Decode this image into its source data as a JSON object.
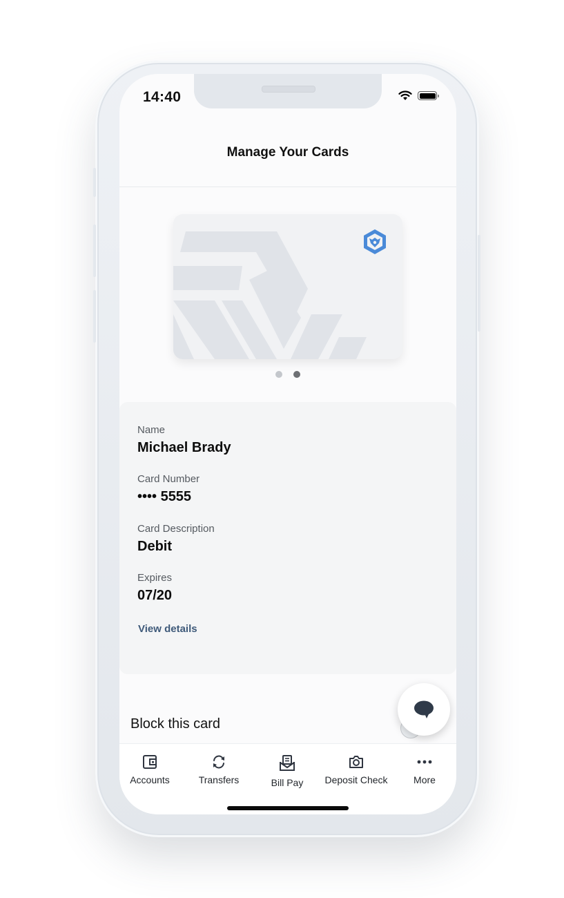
{
  "status_bar": {
    "time": "14:40",
    "icons": [
      "wifi-icon",
      "battery-icon"
    ]
  },
  "header": {
    "title": "Manage Your Cards"
  },
  "card_carousel": {
    "logo_icon": "hexagon-lion-logo-icon",
    "logo_color": "#4a8ad8",
    "page_count": 2,
    "active_page": 2,
    "dot_inactive_color": "#c4c7cc",
    "dot_active_color": "#6e7074"
  },
  "card_details": {
    "fields": [
      {
        "label": "Name",
        "value": "Michael Brady"
      },
      {
        "label": "Card Number",
        "value": "•••• 5555"
      },
      {
        "label": "Card Description",
        "value": "Debit"
      },
      {
        "label": "Expires",
        "value": "07/20"
      }
    ],
    "view_details_label": "View details",
    "link_color": "#3f5a7a"
  },
  "actions": {
    "block_card_label": "Block this card",
    "chat_icon": "chat-bubble-icon"
  },
  "tabbar": {
    "items": [
      {
        "label": "Accounts",
        "icon": "wallet-icon"
      },
      {
        "label": "Transfers",
        "icon": "transfer-arrows-icon"
      },
      {
        "label": "Bill Pay",
        "icon": "bill-envelope-icon"
      },
      {
        "label": "Deposit Check",
        "icon": "camera-icon"
      },
      {
        "label": "More",
        "icon": "more-dots-icon"
      }
    ]
  }
}
